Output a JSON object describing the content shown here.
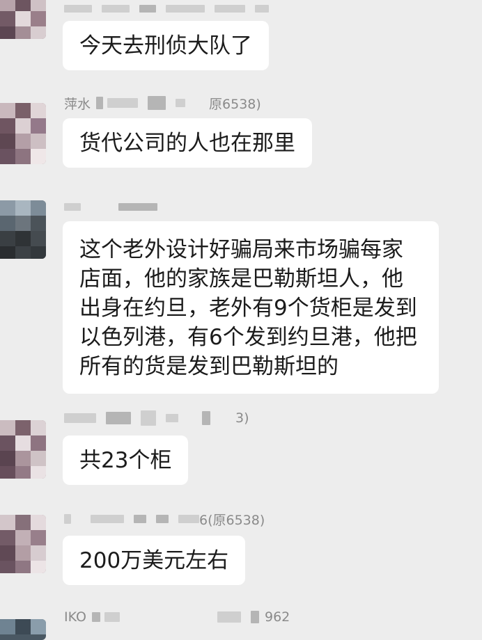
{
  "chat": {
    "messages": [
      {
        "sender_name": "",
        "sender_suffix": "",
        "text": "今天去刑侦大队了"
      },
      {
        "sender_name": "萍水",
        "sender_suffix": "原6538)",
        "text": "货代公司的人也在那里"
      },
      {
        "sender_name": "",
        "sender_suffix": "",
        "text": "这个老外设计好骗局来市场骗每家店面，他的家族是巴勒斯坦人，他出身在约旦，老外有9个货柜是发到以色列港，有6个发到约旦港，他把所有的货是发到巴勒斯坦的"
      },
      {
        "sender_name": "",
        "sender_suffix": "3)",
        "text": "共23个柜"
      },
      {
        "sender_name": "",
        "sender_suffix": "6(原6538)",
        "text": "200万美元左右"
      },
      {
        "sender_name": "IKO",
        "sender_suffix": "962",
        "text": ""
      }
    ]
  }
}
